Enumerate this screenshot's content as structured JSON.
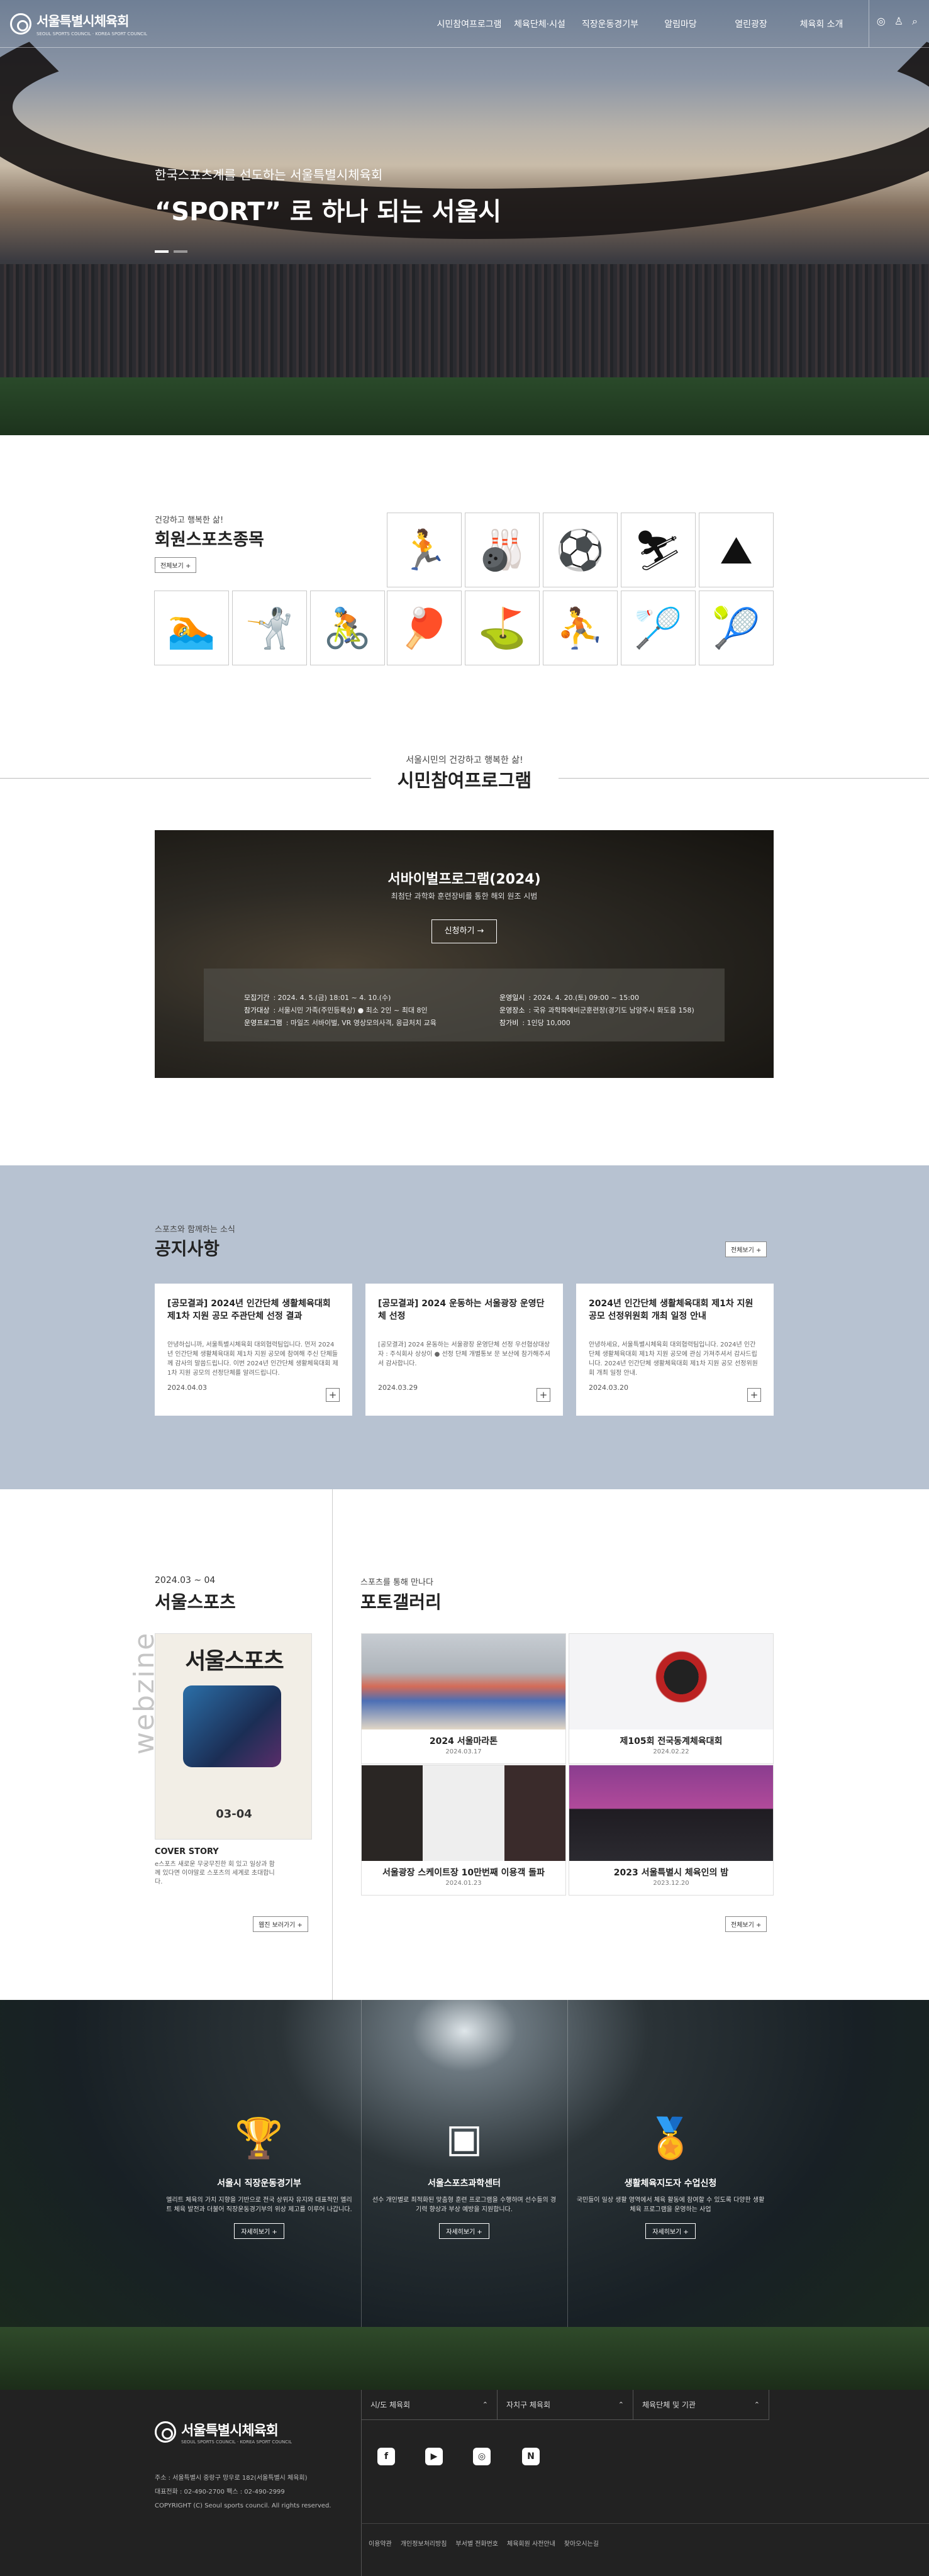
{
  "brand": {
    "name": "서울특별시체육회",
    "sub": "SEOUL SPORTS COUNCIL · KOREA SPORT COUNCIL"
  },
  "nav": [
    "시민참여프로그램",
    "체육단체·시설",
    "직장운동경기부",
    "알림마당",
    "열린광장",
    "체육회 소개"
  ],
  "hero": {
    "eyebrow": "한국스포츠계를 선도하는 서울특별시체육회",
    "headline": "“SPORT” 로 하나 되는 서울시"
  },
  "sports": {
    "label": "건강하고 행복한 삶!",
    "title": "회원스포츠종목",
    "more": "전체보기 +",
    "icons": [
      "running-icon",
      "bowling-icon",
      "soccer-icon",
      "skiing-icon",
      "climbing-icon",
      "swimming-icon",
      "fencing-icon",
      "cycling-icon",
      "table-tennis-icon",
      "gateball-icon",
      "basketball-icon",
      "badminton-icon",
      "tennis-icon"
    ]
  },
  "program": {
    "sub": "서울시민의 건강하고 행복한 삶!",
    "title": "시민참여프로그램",
    "card_title": "서바이벌프로그램(2024)",
    "card_sub": "최첨단 과학화 훈련장비를 통한 해외 원조 시범",
    "apply": "신청하기 →",
    "rows": [
      {
        "k": "모집기간",
        "v": ": 2024. 4. 5.(금) 18:01 ~ 4. 10.(수)"
      },
      {
        "k": "참가대상",
        "v": ": 서울시민 가족(주민등록상) ● 최소 2인 ~ 최대 8인"
      },
      {
        "k": "운영프로그램",
        "v": ": 마일즈 서바이벌, VR 영상모의사격, 응급처치 교육"
      },
      {
        "k": "운영일시",
        "v": ": 2024. 4. 20.(토) 09:00 ~ 15:00"
      },
      {
        "k": "운영장소",
        "v": ": 국유 과학화예비군훈련장(경기도 남양주시 화도읍 158)"
      },
      {
        "k": "참가비",
        "v": ": 1인당 10,000"
      }
    ]
  },
  "notice": {
    "sub": "스포츠와 함께하는 소식",
    "title": "공지사항",
    "more": "전체보기 +",
    "items": [
      {
        "title": "[공모결과] 2024년 인간단체 생활체육대회 제1차 지원 공모 주관단체 선정 결과",
        "body": "안녕하십니까, 서울특별시체육회 대외협력팀입니다. 먼저 2024년 인간단체 생활체육대회 제1차 지원 공모에 참여해 주신 단체들께 감사의 말씀드립니다. 이번 2024년 인간단체 생활체육대회 제1차 지원 공모의 선정단체를 알려드립니다.",
        "date": "2024.04.03"
      },
      {
        "title": "[공모결과] 2024 운동하는 서울광장 운영단체 선정",
        "body": "[공모결과] 2024 운동하는 서울광장 운영단체 선정 우선협상대상자 : 주식회사 상상이 ● 선정 단체 개별통보 문 보산에 참가해주셔서 감사합니다.",
        "date": "2024.03.29"
      },
      {
        "title": "2024년 인간단체 생활체육대회 제1차 지원 공모 선정위원회 개최 일정 안내",
        "body": "안녕하세요, 서울특별시체육회 대외협력팀입니다. 2024년 인간단체 생활체육대회 제1차 지원 공모에 관심 가져주셔서 감사드립니다. 2024년 인간단체 생활체육대회 제1차 지원 공모 선정위원회 개최 일정 안내.",
        "date": "2024.03.20"
      }
    ]
  },
  "magazine": {
    "date": "2024.03 ~ 04",
    "title": "서울스포츠",
    "cover_title": "서울스포츠",
    "issue": "03-04",
    "watermark": "webzine",
    "cs": "COVER STORY",
    "desc": "e스포츠 새로운 무궁무진한 회 있고 일상과 함께 있다면 이야말로 스포츠의 세계로 초대합니다.",
    "more": "웹진 보러가기 +"
  },
  "gallery": {
    "sub": "스포츠를 통해 만나다",
    "title": "포토갤러리",
    "more": "전체보기 +",
    "items": [
      {
        "caption": "2024 서울마라톤",
        "date": "2024.03.17"
      },
      {
        "caption": "제105회 전국동계체육대회",
        "date": "2024.02.22"
      },
      {
        "caption": "서울광장 스케이트장 10만번째 이용객 돌파",
        "date": "2024.01.23"
      },
      {
        "caption": "2023 서울특별시 체육인의 밤",
        "date": "2023.12.20"
      }
    ]
  },
  "services": [
    {
      "icon": "trophy-icon",
      "title": "서울시 직장운동경기부",
      "desc": "엘리트 체육의 가치 지향을 기반으로 전국 상위자 유지와 대표적인 엘리트 체육 발전과 더불어 직장운동경기부의 위상 제고를 이루어 나갑니다.",
      "more": "자세히보기 +"
    },
    {
      "icon": "stadium-icon",
      "title": "서울스포츠과학센터",
      "desc": "선수 개인별로 최적화된 맞춤형 훈련 프로그램을 수행하며 선수들의 경기력 향상과 부상 예방을 지원합니다.",
      "more": "자세히보기 +"
    },
    {
      "icon": "medal-icon",
      "title": "생활체육지도자 수업신청",
      "desc": "국민들이 일상 생활 영역에서 체육 활동에 참여할 수 있도록 다양한 생활 체육 프로그램을 운영하는 사업",
      "more": "자세히보기 +"
    }
  ],
  "footer": {
    "selects": [
      "시/도 체육회",
      "자치구 체육회",
      "체육단체 및 기관"
    ],
    "social": [
      "facebook-icon",
      "youtube-icon",
      "instagram-icon",
      "naver-blog-icon"
    ],
    "address": "주소 : 서울특별시 중랑구 망우로 182(서울특별시 체육회)",
    "phone": "대표전화 : 02-490-2700 팩스 : 02-490-2999",
    "copyright": "COPYRIGHT (C) Seoul sports council. All rights reserved.",
    "links": [
      "이용약관",
      "개인정보처리방침",
      "부서별 전화번호",
      "체육회원 사전안내",
      "찾아오시는길"
    ]
  }
}
